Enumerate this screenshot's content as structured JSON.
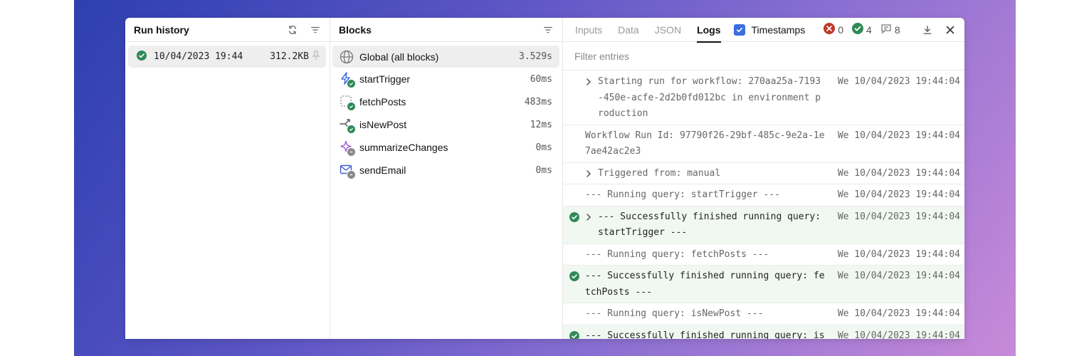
{
  "colors": {
    "success": "#2f8a57",
    "error": "#c0392b",
    "accent": "#3b6fe0"
  },
  "run_history": {
    "title": "Run history",
    "runs": [
      {
        "date": "10/04/2023 19:44",
        "size": "312.2KB"
      }
    ]
  },
  "blocks": {
    "title": "Blocks",
    "items": [
      {
        "name": "Global (all blocks)",
        "time": "3.529s",
        "icon": "globe-icon"
      },
      {
        "name": "startTrigger",
        "time": "60ms",
        "icon": "lightning-icon"
      },
      {
        "name": "fetchPosts",
        "time": "483ms",
        "icon": "resource-query-icon"
      },
      {
        "name": "isNewPost",
        "time": "12ms",
        "icon": "branch-icon"
      },
      {
        "name": "summarizeChanges",
        "time": "0ms",
        "icon": "sparkle-icon"
      },
      {
        "name": "sendEmail",
        "time": "0ms",
        "icon": "email-icon"
      }
    ]
  },
  "logs_panel": {
    "tabs": [
      "Inputs",
      "Data",
      "JSON",
      "Logs"
    ],
    "active_tab": "Logs",
    "timestamps_label": "Timestamps",
    "timestamps_checked": true,
    "counts": {
      "errors": "0",
      "success": "4",
      "messages": "8"
    },
    "filter_placeholder": "Filter entries",
    "entries": [
      {
        "msg": "Starting run for workflow: 270aa25a-7193-450e-acfe-2d2b0fd012bc in environment production",
        "ts": "We 10/04/2023 19:44:04",
        "expandable": true,
        "success": false
      },
      {
        "msg": "Workflow Run Id: 97790f26-29bf-485c-9e2a-1e7ae42ac2e3",
        "ts": "We 10/04/2023 19:44:04",
        "expandable": false,
        "success": false
      },
      {
        "msg": "Triggered from: manual",
        "ts": "We 10/04/2023 19:44:04",
        "expandable": true,
        "success": false
      },
      {
        "msg": "--- Running query: startTrigger ---",
        "ts": "We 10/04/2023 19:44:04",
        "expandable": false,
        "success": false
      },
      {
        "msg": "--- Successfully finished running query: startTrigger ---",
        "ts": "We 10/04/2023 19:44:04",
        "expandable": true,
        "success": true
      },
      {
        "msg": "--- Running query: fetchPosts ---",
        "ts": "We 10/04/2023 19:44:04",
        "expandable": false,
        "success": false
      },
      {
        "msg": "--- Successfully finished running query: fetchPosts ---",
        "ts": "We 10/04/2023 19:44:04",
        "expandable": false,
        "success": true
      },
      {
        "msg": "--- Running query: isNewPost ---",
        "ts": "We 10/04/2023 19:44:04",
        "expandable": false,
        "success": false
      },
      {
        "msg": "--- Successfully finished running query: isNewPost ---",
        "ts": "We 10/04/2023 19:44:04",
        "expandable": false,
        "success": true
      }
    ]
  }
}
